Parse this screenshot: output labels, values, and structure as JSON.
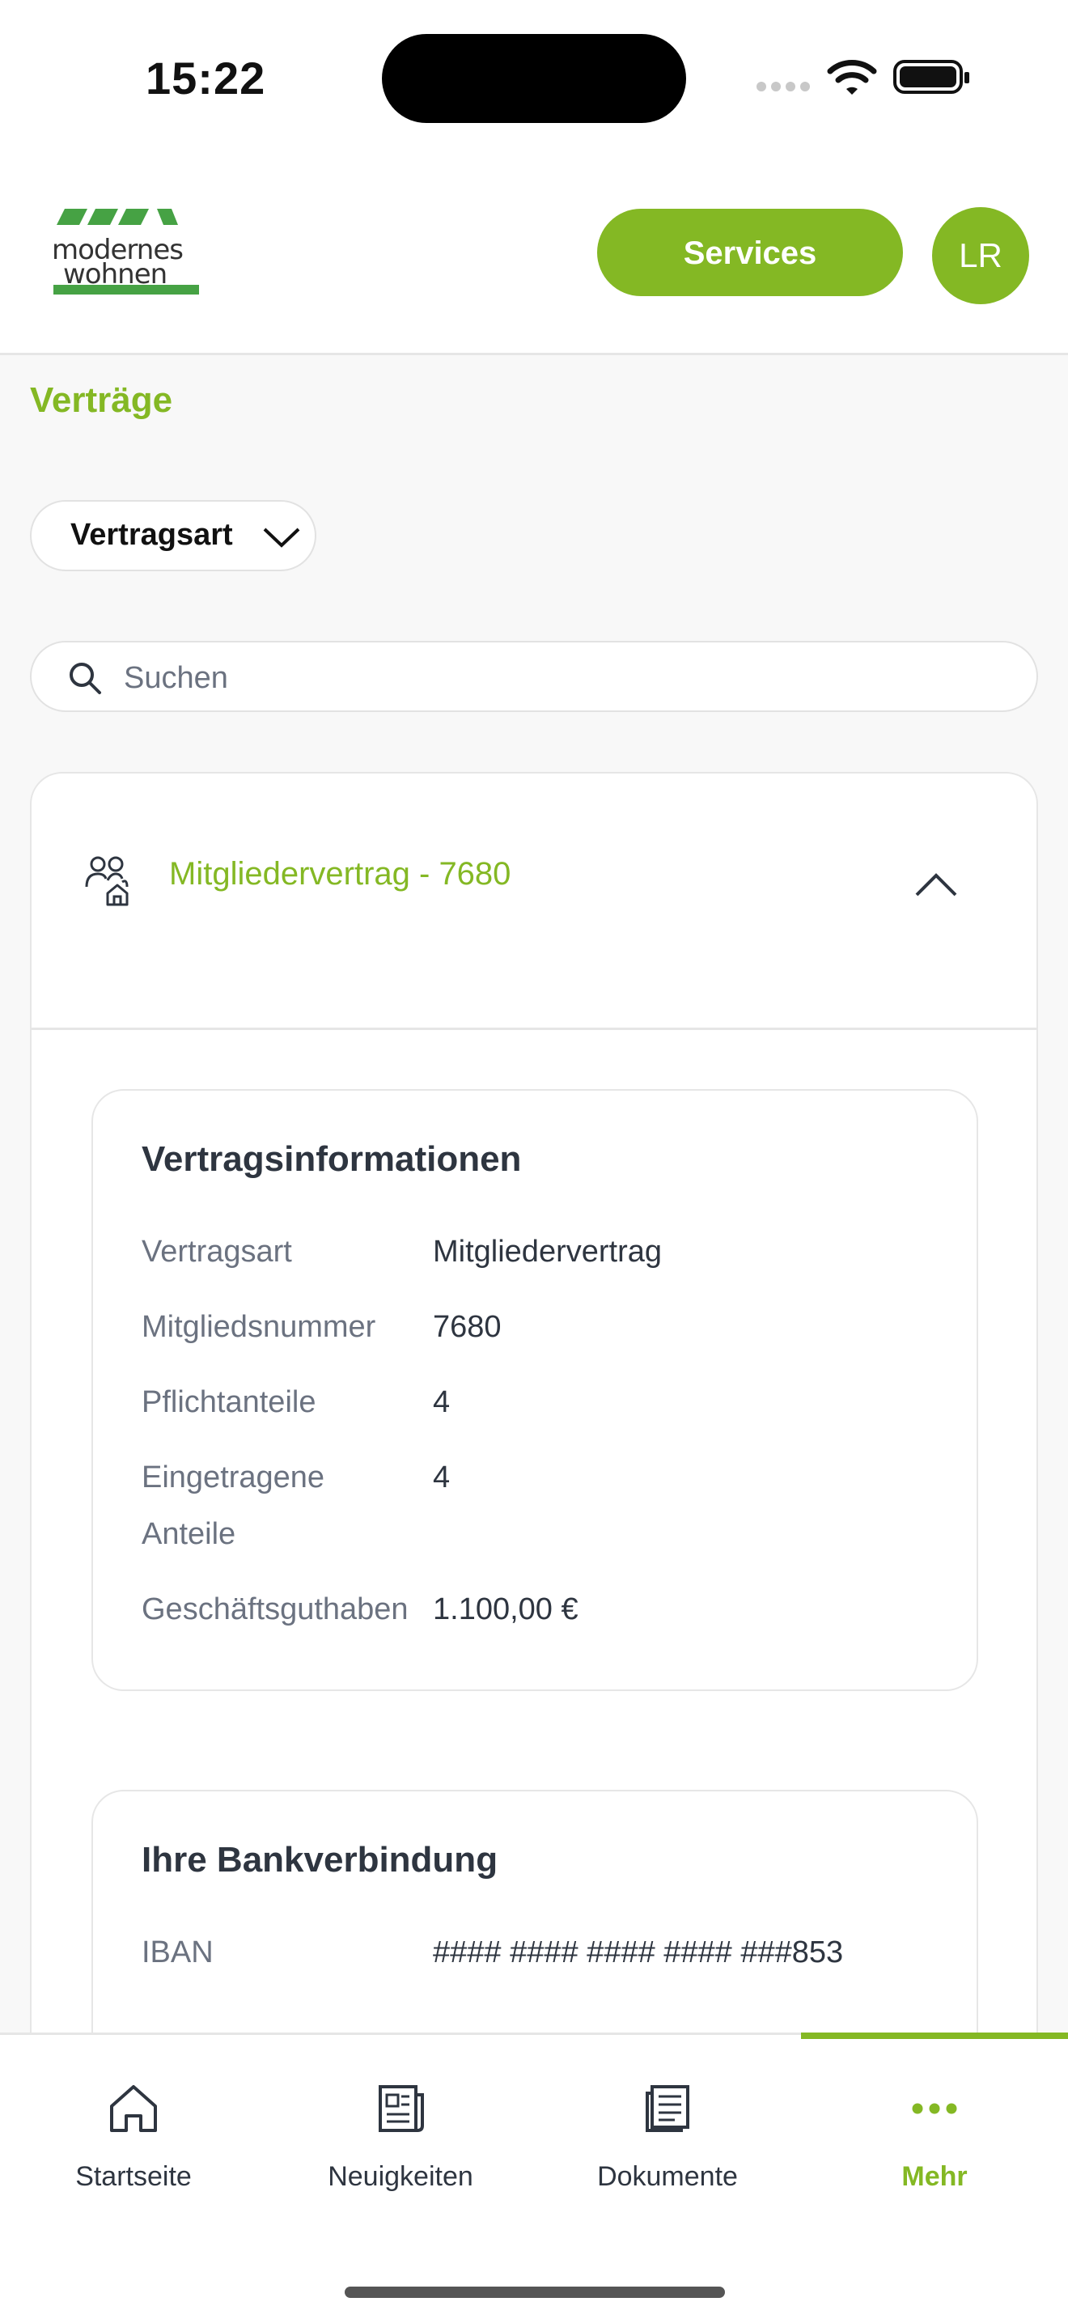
{
  "status_bar": {
    "time": "15:22"
  },
  "header": {
    "logo_text_line1": "modernes",
    "logo_text_line2": "wohnen",
    "services_label": "Services",
    "avatar_initials": "LR"
  },
  "page": {
    "title": "Verträge",
    "filter_label": "Vertragsart",
    "search_placeholder": "Suchen"
  },
  "contract": {
    "title": "Mitgliedervertrag - 7680",
    "info": {
      "heading": "Vertragsinformationen",
      "rows": [
        {
          "label": "Vertragsart",
          "value": "Mitgliedervertrag"
        },
        {
          "label": "Mitgliedsnummer",
          "value": "7680"
        },
        {
          "label": "Pflichtanteile",
          "value": "4"
        },
        {
          "label": "Eingetragene Anteile",
          "value": "4"
        },
        {
          "label": "Geschäftsguthaben",
          "value": "1.100,00 €"
        }
      ]
    },
    "bank": {
      "heading": "Ihre Bankverbindung",
      "rows": [
        {
          "label": "IBAN",
          "value": "#### #### #### #### ###853"
        }
      ]
    }
  },
  "tabs": [
    {
      "label": "Startseite",
      "icon": "home-icon"
    },
    {
      "label": "Neuigkeiten",
      "icon": "newspaper-icon"
    },
    {
      "label": "Dokumente",
      "icon": "document-icon"
    },
    {
      "label": "Mehr",
      "icon": "more-icon",
      "active": true
    }
  ],
  "colors": {
    "accent": "#84b824",
    "text": "#2e3540",
    "muted": "#6b7280"
  }
}
